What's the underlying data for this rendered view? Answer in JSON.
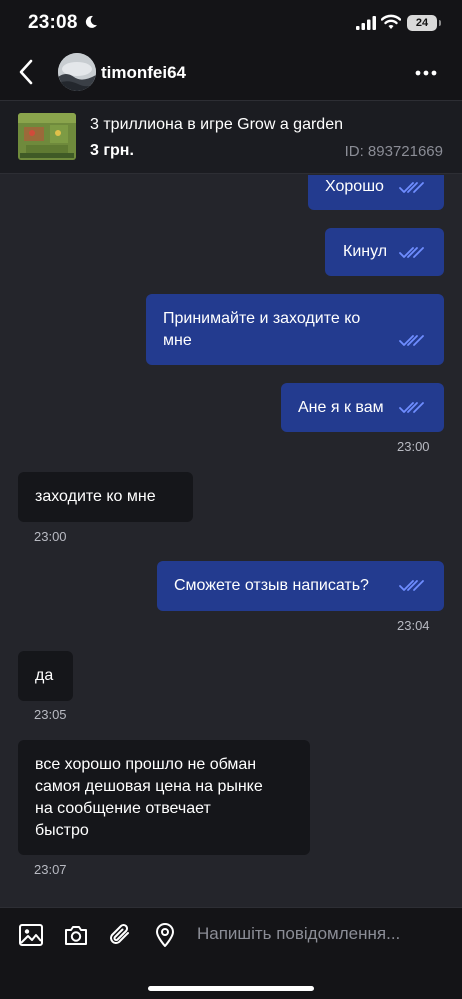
{
  "status_bar": {
    "time": "23:08",
    "battery": "24"
  },
  "header": {
    "username": "timonfei64"
  },
  "ad": {
    "title": "3 триллиона в игре Grow a garden",
    "price": "3 грн.",
    "id": "ID: 893721669"
  },
  "messages": [
    {
      "dir": "out",
      "text": "Хорошо",
      "read": true
    },
    {
      "dir": "out",
      "text": "Кинул",
      "read": true
    },
    {
      "dir": "out",
      "lines": [
        "Принимайте и заходите ко",
        "мне"
      ],
      "read": true
    },
    {
      "dir": "out",
      "text": "Ане я к вам",
      "read": true,
      "time": "23:00"
    },
    {
      "dir": "in",
      "text": "заходите ко мне",
      "time": "23:00"
    },
    {
      "dir": "out",
      "text": "Сможете отзыв написать?",
      "read": true,
      "time": "23:04"
    },
    {
      "dir": "in",
      "text": "да",
      "time": "23:05"
    },
    {
      "dir": "in",
      "lines": [
        "все хорошо прошло не обман",
        "самоя дешовая цена на рынке",
        "на сообщение отвечает",
        "быстро"
      ],
      "time": "23:07"
    }
  ],
  "composer": {
    "placeholder": "Напишіть повідомлення..."
  },
  "icons": [
    "back-arrow-icon",
    "more-icon",
    "image-icon",
    "camera-icon",
    "paperclip-icon",
    "location-icon",
    "double-check-icon"
  ],
  "colors": {
    "outgoing": "#233b8f",
    "incoming": "#15161a",
    "read_ticks": "#6f8dff"
  }
}
